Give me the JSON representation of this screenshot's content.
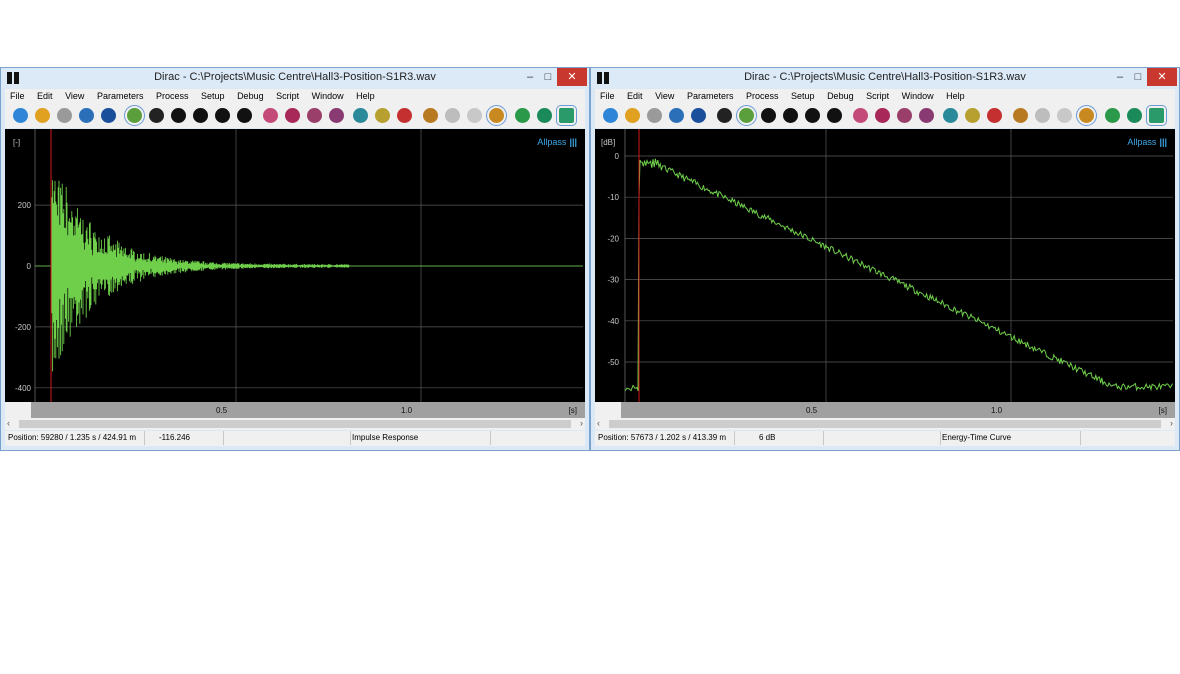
{
  "windows": [
    {
      "title": "Dirac - C:\\Projects\\Music Centre\\Hall3-Position-S1R3.wav",
      "menu": [
        "File",
        "Edit",
        "View",
        "Parameters",
        "Process",
        "Setup",
        "Debug",
        "Script",
        "Window",
        "Help"
      ],
      "allpass_label": "Allpass",
      "y_unit": "[-]",
      "y_ticks": [
        "200",
        "0",
        "-200",
        "-400"
      ],
      "x_unit": "[s]",
      "x_ticks": [
        "0.5",
        "1.0"
      ],
      "status": {
        "position": "Position: 59280 / 1.235 s / 424.91 m",
        "value": "-116.246",
        "mode": "Impulse Response"
      }
    },
    {
      "title": "Dirac - C:\\Projects\\Music Centre\\Hall3-Position-S1R3.wav",
      "menu": [
        "File",
        "Edit",
        "View",
        "Parameters",
        "Process",
        "Setup",
        "Debug",
        "Script",
        "Window",
        "Help"
      ],
      "allpass_label": "Allpass",
      "y_unit": "[dB]",
      "y_ticks": [
        "0",
        "-10",
        "-20",
        "-30",
        "-40",
        "-50"
      ],
      "x_unit": "[s]",
      "x_ticks": [
        "0.5",
        "1.0"
      ],
      "status": {
        "position": "Position: 57673 / 1.202 s / 413.39 m",
        "value": "6 dB",
        "mode": "Energy-Time Curve"
      }
    }
  ],
  "colors": {
    "trace": "#6fcf4b",
    "cursor": "#d01818",
    "accent": "#3da8e8"
  },
  "toolbar_icons": [
    "new-icon",
    "open-icon",
    "save-icon",
    "print-icon",
    "record-icon",
    "waveform-icon",
    "filter-icon",
    "curve-icon",
    "slope-icon",
    "bars-icon",
    "phi-icon",
    "palette-icon",
    "target-icon",
    "grid-icon",
    "chart-icon",
    "pen-icon",
    "pause-icon",
    "tool-icon",
    "plus-icon",
    "minus-icon",
    "arrows-icon",
    "info-icon",
    "rec-icon",
    "play-icon",
    "stop-icon"
  ]
}
